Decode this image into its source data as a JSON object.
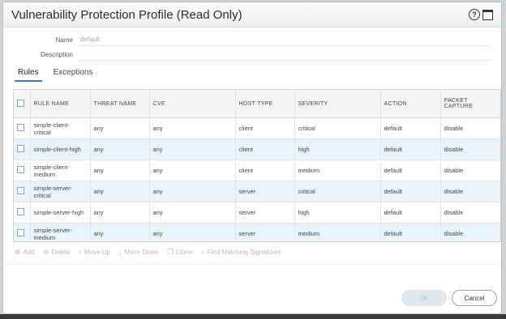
{
  "dialog": {
    "title": "Vulnerability Protection Profile (Read Only)",
    "help_icon": "?"
  },
  "form": {
    "name_label": "Name",
    "name_value": "default",
    "description_label": "Description",
    "description_value": ""
  },
  "tabs": [
    {
      "label": "Rules",
      "active": true
    },
    {
      "label": "Exceptions",
      "active": false
    }
  ],
  "table": {
    "columns": [
      "RULE NAME",
      "THREAT NAME",
      "CVE",
      "HOST TYPE",
      "SEVERITY",
      "ACTION",
      "PACKET CAPTURE"
    ],
    "rows": [
      {
        "name": "simple-client-critical",
        "threat": "any",
        "cve": "any",
        "host": "client",
        "severity": "critical",
        "action": "default",
        "capture": "disable"
      },
      {
        "name": "simple-client-high",
        "threat": "any",
        "cve": "any",
        "host": "client",
        "severity": "high",
        "action": "default",
        "capture": "disable"
      },
      {
        "name": "simple-client-medium",
        "threat": "any",
        "cve": "any",
        "host": "client",
        "severity": "medium",
        "action": "default",
        "capture": "disable"
      },
      {
        "name": "simple-server-critical",
        "threat": "any",
        "cve": "any",
        "host": "server",
        "severity": "critical",
        "action": "default",
        "capture": "disable"
      },
      {
        "name": "simple-server-high",
        "threat": "any",
        "cve": "any",
        "host": "server",
        "severity": "high",
        "action": "default",
        "capture": "disable"
      },
      {
        "name": "simple-server-medium",
        "threat": "any",
        "cve": "any",
        "host": "server",
        "severity": "medium",
        "action": "default",
        "capture": "disable"
      }
    ]
  },
  "toolbar": {
    "add": "Add",
    "delete": "Delete",
    "move_up": "Move Up",
    "move_down": "Move Down",
    "clone": "Clone",
    "find": "Find Matching Signatures"
  },
  "buttons": {
    "ok": "OK",
    "cancel": "Cancel"
  }
}
